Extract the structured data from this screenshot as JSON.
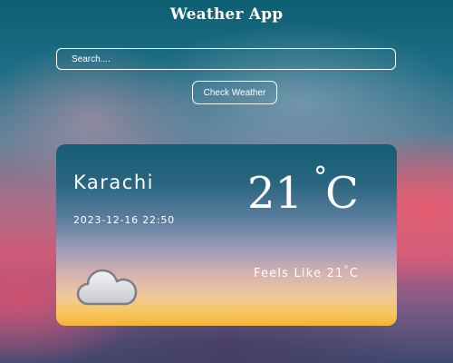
{
  "app": {
    "title": "Weather App"
  },
  "search": {
    "placeholder": "Search....",
    "value": ""
  },
  "actions": {
    "check_label": "Check Weather"
  },
  "weather": {
    "city": "Karachi",
    "datetime": "2023-12-16 22:50",
    "temperature": "21",
    "degree_symbol": "°",
    "unit": "C",
    "feels_like_label": "Feels Like",
    "feels_like_value": "21",
    "condition_icon": "cloud-icon"
  }
}
